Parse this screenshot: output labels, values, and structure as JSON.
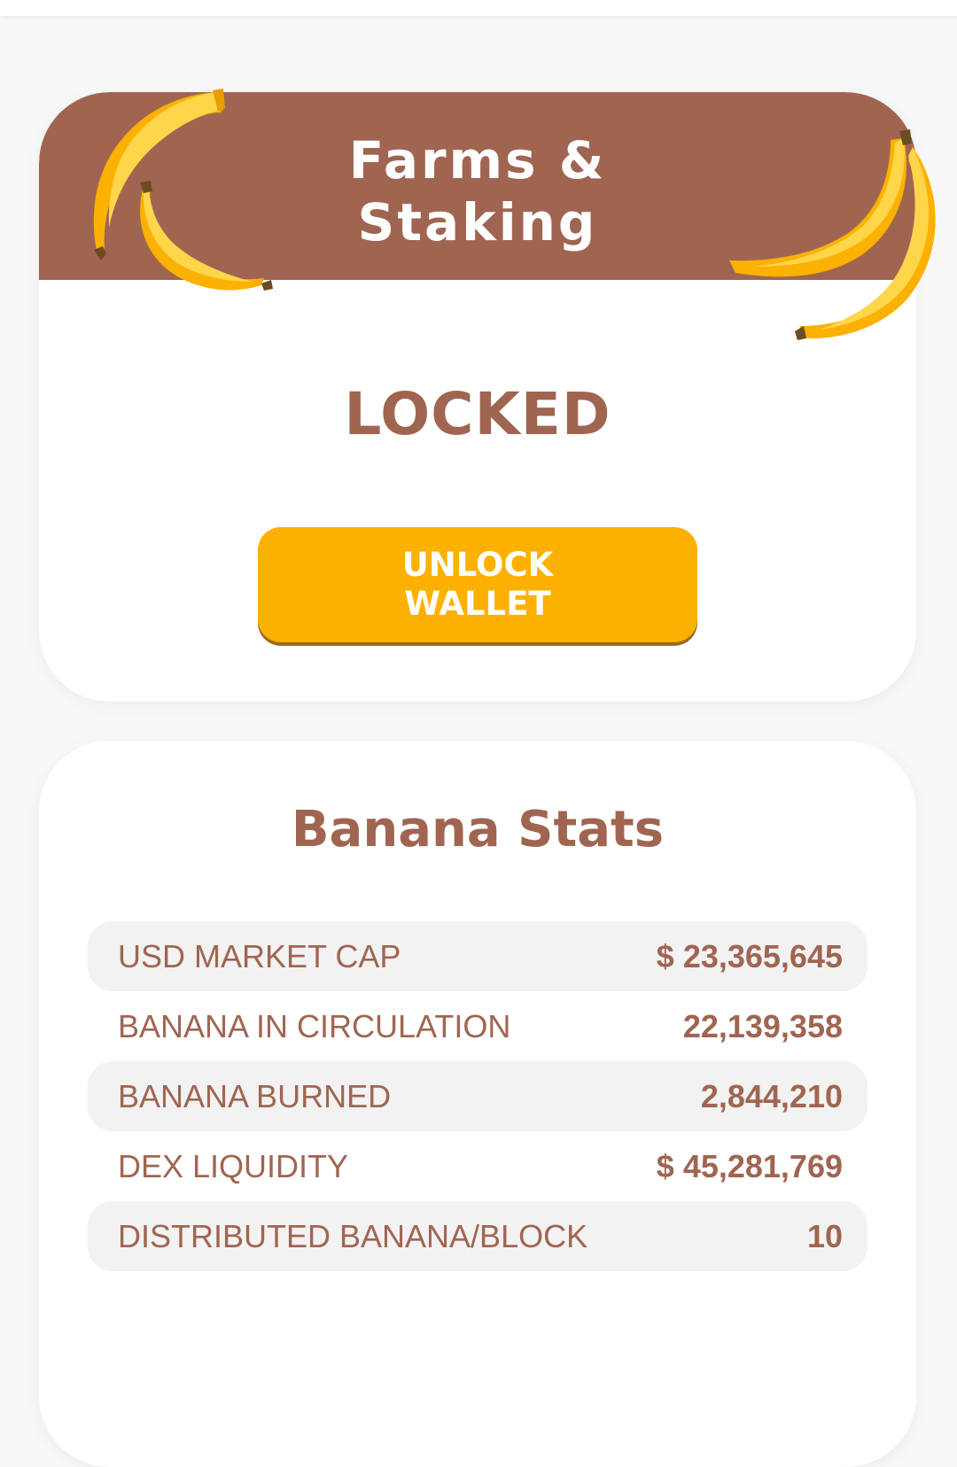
{
  "farms_card": {
    "title": "Farms &\nStaking",
    "status": "LOCKED",
    "unlock_button_label": "UNLOCK\nWALLET"
  },
  "stats_card": {
    "title": "Banana Stats",
    "rows": [
      {
        "label": "USD MARKET CAP",
        "value": "$ 23,365,645"
      },
      {
        "label": "BANANA IN CIRCULATION",
        "value": "22,139,358"
      },
      {
        "label": "BANANA BURNED",
        "value": "2,844,210"
      },
      {
        "label": "DEX LIQUIDITY",
        "value": "$ 45,281,769"
      },
      {
        "label": "DISTRIBUTED BANANA/BLOCK",
        "value": "10"
      }
    ]
  },
  "icons": {
    "banana_left": "banana-icon",
    "banana_right": "banana-icon"
  },
  "colors": {
    "brand_brown": "#a06551",
    "brand_yellow": "#fcb100",
    "background": "#f8f8f8",
    "row_shade": "#f2f2f2"
  }
}
